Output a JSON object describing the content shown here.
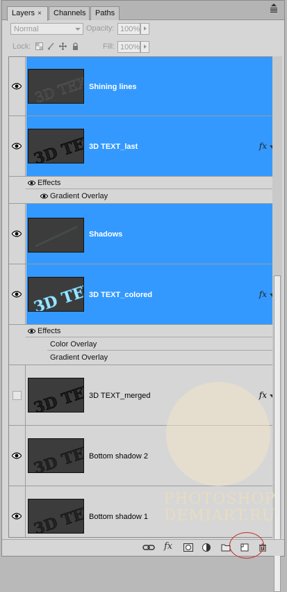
{
  "tabs": [
    {
      "label": "Layers",
      "close": "×",
      "active": true
    },
    {
      "label": "Channels",
      "active": false
    },
    {
      "label": "Paths",
      "active": false
    }
  ],
  "blend_mode": "Normal",
  "opacity": {
    "label": "Opacity:",
    "value": "100%"
  },
  "lock": {
    "label": "Lock:"
  },
  "fill": {
    "label": "Fill:",
    "value": "100%"
  },
  "layers": [
    {
      "name": "Shining lines",
      "selected": true,
      "visible": true,
      "has_fx": false,
      "thumb_text": "3D TEXT"
    },
    {
      "name": "3D TEXT_last",
      "selected": true,
      "visible": true,
      "has_fx": true,
      "fx_label": "fx",
      "thumb_text": "3D TEXT"
    },
    {
      "name": "Shadows",
      "selected": true,
      "visible": true,
      "has_fx": false,
      "thumb_text": ""
    },
    {
      "name": "3D TEXT_colored",
      "selected": true,
      "visible": true,
      "has_fx": true,
      "fx_label": "fx",
      "thumb_text": "3D TEXT"
    },
    {
      "name": "3D TEXT_merged",
      "selected": false,
      "visible": false,
      "has_fx": true,
      "fx_label": "fx",
      "thumb_text": "3D TEXT"
    },
    {
      "name": "Bottom shadow 2",
      "selected": false,
      "visible": true,
      "has_fx": false,
      "thumb_text": "3D TEXT"
    },
    {
      "name": "Bottom shadow 1",
      "selected": false,
      "visible": true,
      "has_fx": false,
      "thumb_text": "3D TEXT"
    }
  ],
  "effects_last": {
    "header": "Effects",
    "items": [
      "Gradient Overlay"
    ]
  },
  "effects_colored": {
    "header": "Effects",
    "items": [
      "Color Overlay",
      "Gradient Overlay"
    ]
  },
  "watermark": {
    "line1": "PHOTOSHOP",
    "line2": "DEMIART.RU"
  },
  "footer_icons": [
    "link-layers-icon",
    "fx-icon",
    "mask-icon",
    "adjustment-icon",
    "group-folder-icon",
    "new-layer-icon",
    "trash-icon"
  ],
  "footer_fx": "fx",
  "colors": {
    "selection": "#3399ff",
    "panel": "#d6d6d6",
    "highlight_circle": "#cc2222"
  }
}
